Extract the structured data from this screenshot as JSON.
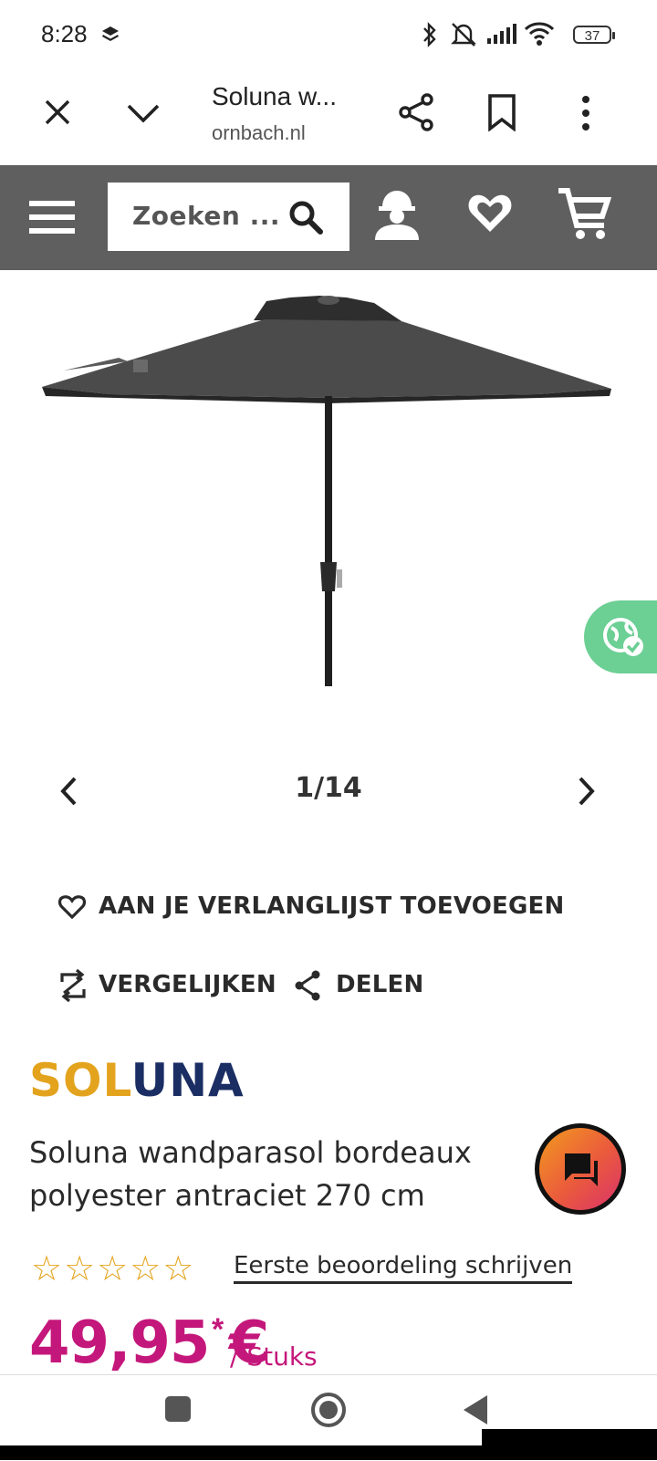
{
  "status_bar": {
    "time": "8:28",
    "battery": "37"
  },
  "browser": {
    "title": "Soluna w...",
    "url": "ornbach.nl"
  },
  "site_header": {
    "search_placeholder": "Zoeken ..."
  },
  "gallery": {
    "counter": "1/14"
  },
  "actions": {
    "wishlist": "AAN JE VERLANGLIJST TOEVOEGEN",
    "compare": "VERGELIJKEN",
    "share": "DELEN"
  },
  "product": {
    "brand_part1": "SOL",
    "brand_part2": "UNA",
    "name": "Soluna wandparasol bordeaux polyester antraciet 270 cm",
    "stars": "☆☆☆☆☆",
    "review_link": "Eerste beoordeling schrijven",
    "price": "49,95 €",
    "price_mark": "*",
    "unit": "/ Stuks"
  },
  "colors": {
    "header": "#5f5f5f",
    "price": "#c4177b",
    "star": "#e3a31d",
    "brand_gold": "#e3a31d",
    "brand_navy": "#1b2e63",
    "globe_tab": "#6ccf94"
  }
}
